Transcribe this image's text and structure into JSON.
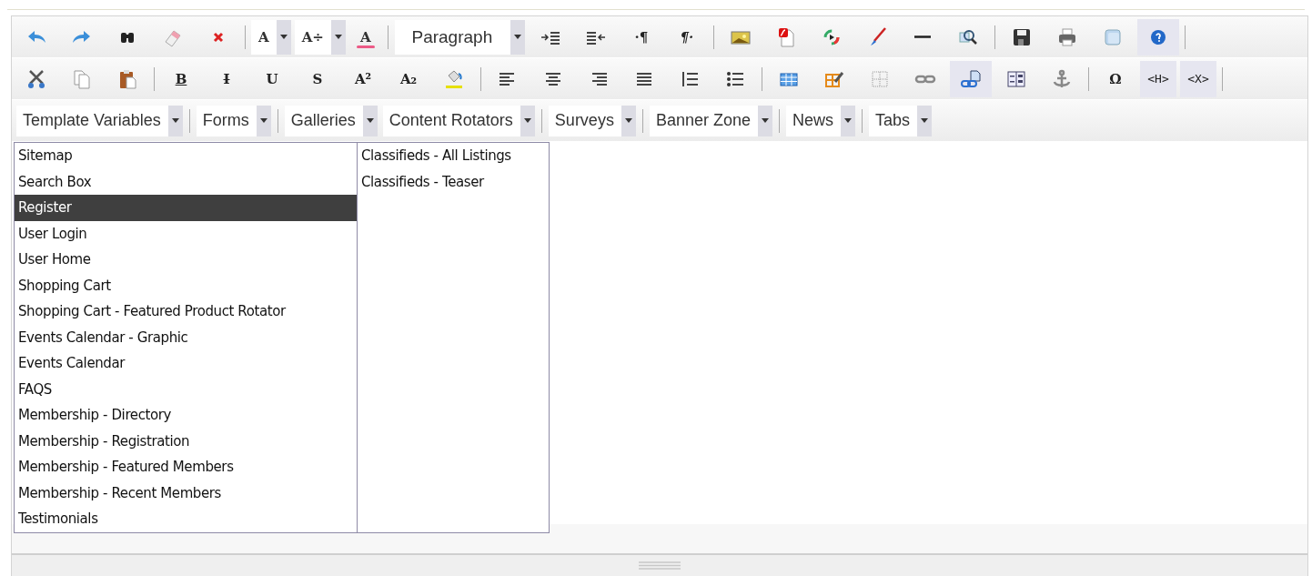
{
  "toolbars": [
    {
      "items": [
        {
          "kind": "icon",
          "active": false
        },
        {
          "kind": "icon",
          "active": false
        },
        {
          "kind": "icon",
          "active": false
        },
        {
          "kind": "icon",
          "active": false
        },
        {
          "kind": "icon",
          "active": false
        },
        {
          "kind": "separator"
        },
        {
          "kind": "glyph-dropdown",
          "label": "A"
        },
        {
          "kind": "glyph-dropdown",
          "label": "A÷"
        },
        {
          "kind": "color-glyph",
          "label": "A"
        },
        {
          "kind": "separator"
        },
        {
          "kind": "dropdown",
          "value": "Paragraph"
        },
        {
          "kind": "icon",
          "active": false
        },
        {
          "kind": "icon",
          "active": false
        },
        {
          "kind": "glyph",
          "label": "·¶",
          "active": false
        },
        {
          "kind": "glyph",
          "label": "¶·",
          "active": false
        },
        {
          "kind": "separator"
        },
        {
          "kind": "icon",
          "active": false
        },
        {
          "kind": "icon",
          "active": false
        },
        {
          "kind": "icon",
          "active": false
        },
        {
          "kind": "icon",
          "active": false
        },
        {
          "kind": "icon",
          "active": false
        },
        {
          "kind": "icon",
          "active": false
        },
        {
          "kind": "separator"
        },
        {
          "kind": "icon",
          "active": false
        },
        {
          "kind": "icon",
          "active": false
        },
        {
          "kind": "icon",
          "active": false
        },
        {
          "kind": "icon",
          "active": true
        },
        {
          "kind": "separator"
        }
      ]
    },
    {
      "items": [
        {
          "kind": "icon",
          "active": false
        },
        {
          "kind": "icon",
          "active": false
        },
        {
          "kind": "icon",
          "active": false
        },
        {
          "kind": "separator"
        },
        {
          "kind": "glyph",
          "label": "B",
          "active": false
        },
        {
          "kind": "glyph",
          "label": "I",
          "active": false
        },
        {
          "kind": "glyph",
          "label": "U",
          "active": false
        },
        {
          "kind": "glyph",
          "label": "S",
          "active": false
        },
        {
          "kind": "glyph",
          "label": "A²",
          "active": false
        },
        {
          "kind": "glyph",
          "label": "A₂",
          "active": false
        },
        {
          "kind": "icon",
          "active": false
        },
        {
          "kind": "separator"
        },
        {
          "kind": "icon",
          "active": false
        },
        {
          "kind": "icon",
          "active": false
        },
        {
          "kind": "icon",
          "active": false
        },
        {
          "kind": "icon",
          "active": false
        },
        {
          "kind": "icon",
          "active": false
        },
        {
          "kind": "icon",
          "active": false
        },
        {
          "kind": "separator"
        },
        {
          "kind": "icon",
          "active": false
        },
        {
          "kind": "icon",
          "active": false
        },
        {
          "kind": "icon",
          "active": false
        },
        {
          "kind": "icon",
          "active": false
        },
        {
          "kind": "icon",
          "active": true
        },
        {
          "kind": "icon",
          "active": false
        },
        {
          "kind": "icon",
          "active": false
        },
        {
          "kind": "separator"
        },
        {
          "kind": "glyph",
          "label": "Ω",
          "active": false
        },
        {
          "kind": "glyph",
          "label": "<H>",
          "active": true
        },
        {
          "kind": "glyph",
          "label": "<X>",
          "active": true
        },
        {
          "kind": "separator"
        }
      ]
    },
    {
      "items": [
        {
          "kind": "dropdown",
          "value": "Template Variables"
        },
        {
          "kind": "separator"
        },
        {
          "kind": "dropdown",
          "value": "Forms"
        },
        {
          "kind": "separator"
        },
        {
          "kind": "dropdown",
          "value": "Galleries"
        },
        {
          "kind": "dropdown",
          "value": "Content Rotators"
        },
        {
          "kind": "separator"
        },
        {
          "kind": "dropdown",
          "value": "Surveys"
        },
        {
          "kind": "separator"
        },
        {
          "kind": "dropdown",
          "value": "Banner Zone"
        },
        {
          "kind": "separator"
        },
        {
          "kind": "dropdown",
          "value": "News"
        },
        {
          "kind": "separator"
        },
        {
          "kind": "dropdown",
          "value": "Tabs"
        }
      ]
    }
  ],
  "lists": [
    {
      "items": [
        {
          "label": "Sitemap",
          "selected": false
        },
        {
          "label": "Search Box",
          "selected": false
        },
        {
          "label": "Register",
          "selected": true
        },
        {
          "label": "User Login",
          "selected": false
        },
        {
          "label": "User Home",
          "selected": false
        },
        {
          "label": "Shopping Cart",
          "selected": false
        },
        {
          "label": "Shopping Cart - Featured Product Rotator",
          "selected": false
        },
        {
          "label": "Events Calendar - Graphic",
          "selected": false
        },
        {
          "label": "Events Calendar",
          "selected": false
        },
        {
          "label": "FAQS",
          "selected": false
        },
        {
          "label": "Membership - Directory",
          "selected": false
        },
        {
          "label": "Membership - Registration",
          "selected": false
        },
        {
          "label": "Membership - Featured Members",
          "selected": false
        },
        {
          "label": "Membership - Recent Members",
          "selected": false
        },
        {
          "label": "Testimonials",
          "selected": false
        }
      ]
    },
    {
      "items": [
        {
          "label": "Classifieds - All Listings",
          "selected": false
        },
        {
          "label": "Classifieds - Teaser",
          "selected": false
        }
      ]
    }
  ]
}
